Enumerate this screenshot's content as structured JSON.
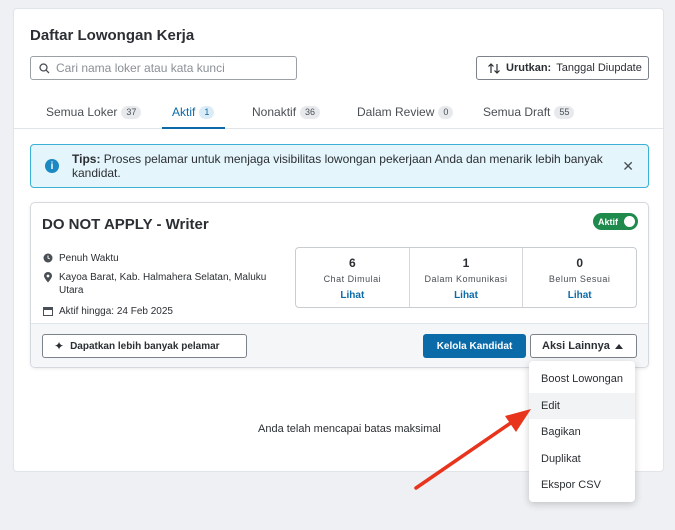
{
  "page": {
    "title": "Daftar Lowongan Kerja"
  },
  "search": {
    "placeholder": "Cari nama loker atau kata kunci"
  },
  "sort": {
    "label": "Urutkan:",
    "value": "Tanggal Diupdate"
  },
  "tabs": [
    {
      "label": "Semua Loker",
      "count": "37"
    },
    {
      "label": "Aktif",
      "count": "1",
      "active": true
    },
    {
      "label": "Nonaktif",
      "count": "36"
    },
    {
      "label": "Dalam Review",
      "count": "0"
    },
    {
      "label": "Semua Draft",
      "count": "55"
    }
  ],
  "tips": {
    "title": "Tips:",
    "text": "Proses pelamar untuk menjaga visibilitas lowongan pekerjaan Anda dan menarik lebih banyak kandidat.",
    "close": "✕"
  },
  "job": {
    "title": "DO NOT APPLY - Writer",
    "status": "Aktif",
    "type": "Penuh Waktu",
    "location": "Kayoa Barat, Kab. Halmahera Selatan, Maluku Utara",
    "active_until": "Aktif hingga: 24 Feb 2025",
    "stats": [
      {
        "value": "6",
        "label": "Chat Dimulai",
        "link": "Lihat"
      },
      {
        "value": "1",
        "label": "Dalam Komunikasi",
        "link": "Lihat"
      },
      {
        "value": "0",
        "label": "Belum Sesuai",
        "link": "Lihat"
      }
    ],
    "more_applicants_label": "Dapatkan lebih banyak pelamar",
    "manage_label": "Kelola Kandidat",
    "other_actions_label": "Aksi Lainnya"
  },
  "dropdown": {
    "items": [
      "Boost Lowongan",
      "Edit",
      "Bagikan",
      "Duplikat",
      "Ekspor CSV"
    ],
    "highlighted": "Edit"
  },
  "limit_message": "Anda telah mencapai batas maksimal",
  "colors": {
    "primary": "#0b6aa8",
    "success": "#1e8a4c",
    "tips_bg": "#e4f5fb",
    "arrow": "#e8341c"
  }
}
